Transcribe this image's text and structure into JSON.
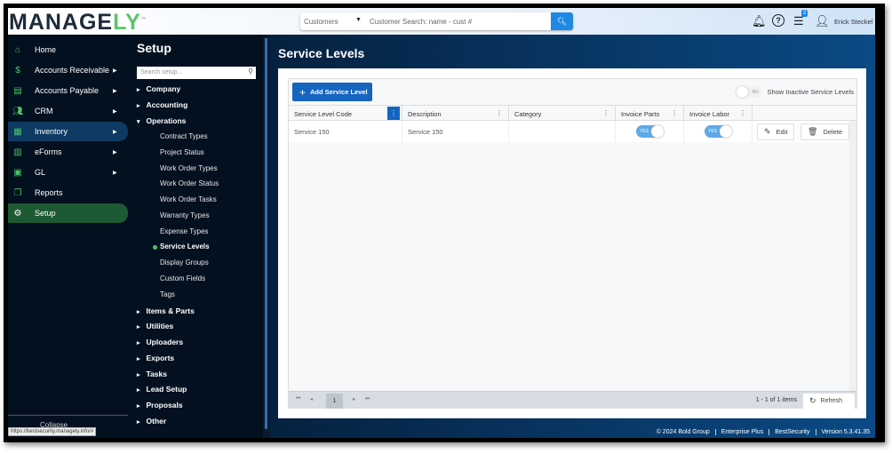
{
  "header": {
    "logo_main": "MANAGE",
    "logo_accent": "LY",
    "logo_tm": "™",
    "search_scope": "Customers",
    "search_placeholder": "Customer Search: name - cust #",
    "task_badge": "2",
    "user_name": "Erick Steckel"
  },
  "nav": {
    "items": [
      {
        "label": "Home",
        "icon": "home-icon"
      },
      {
        "label": "Accounts Receivable",
        "icon": "hand-dollar-icon"
      },
      {
        "label": "Accounts Payable",
        "icon": "bill-icon"
      },
      {
        "label": "CRM",
        "icon": "people-icon"
      },
      {
        "label": "Inventory",
        "icon": "boxes-icon"
      },
      {
        "label": "eForms",
        "icon": "forms-icon"
      },
      {
        "label": "GL",
        "icon": "ledger-icon"
      },
      {
        "label": "Reports",
        "icon": "reports-icon"
      },
      {
        "label": "Setup",
        "icon": "gear-icon"
      }
    ],
    "collapse": "Collapse",
    "status_url": "https://bestsecurity.managely.info/#"
  },
  "setup": {
    "title": "Setup",
    "search_placeholder": "Search setup...",
    "groups_before": [
      "Company",
      "Accounting"
    ],
    "open_group": "Operations",
    "sub_items": [
      "Contract Types",
      "Project Status",
      "Work Order Types",
      "Work Order Status",
      "Work Order Tasks",
      "Warranty Types",
      "Expense Types",
      "Service Levels",
      "Display Groups",
      "Custom Fields",
      "Tags"
    ],
    "active_item": "Service Levels",
    "groups_after": [
      "Items & Parts",
      "Utilities",
      "Uploaders",
      "Exports",
      "Tasks",
      "Lead Setup",
      "Proposals",
      "Other"
    ]
  },
  "main": {
    "title": "Service Levels",
    "add_button": "Add Service Level",
    "inactive_toggle": {
      "label": "Show Inactive Service Levels",
      "state": "NO"
    },
    "columns": [
      "Service Level Code",
      "Description",
      "Category",
      "Invoice Parts",
      "Invoice Labor"
    ],
    "rows": [
      {
        "code": "Service 150",
        "description": "Service 150",
        "category": "",
        "invoice_parts": "YES",
        "invoice_labor": "YES"
      }
    ],
    "edit": "Edit",
    "delete": "Delete",
    "pager": {
      "page": "1",
      "count": "1 - 1 of 1 items",
      "refresh": "Refresh"
    }
  },
  "footer": [
    "© 2024 Bold Group",
    "Enterprise Plus",
    "BestSecurity",
    "Version 5.3.41.35"
  ]
}
